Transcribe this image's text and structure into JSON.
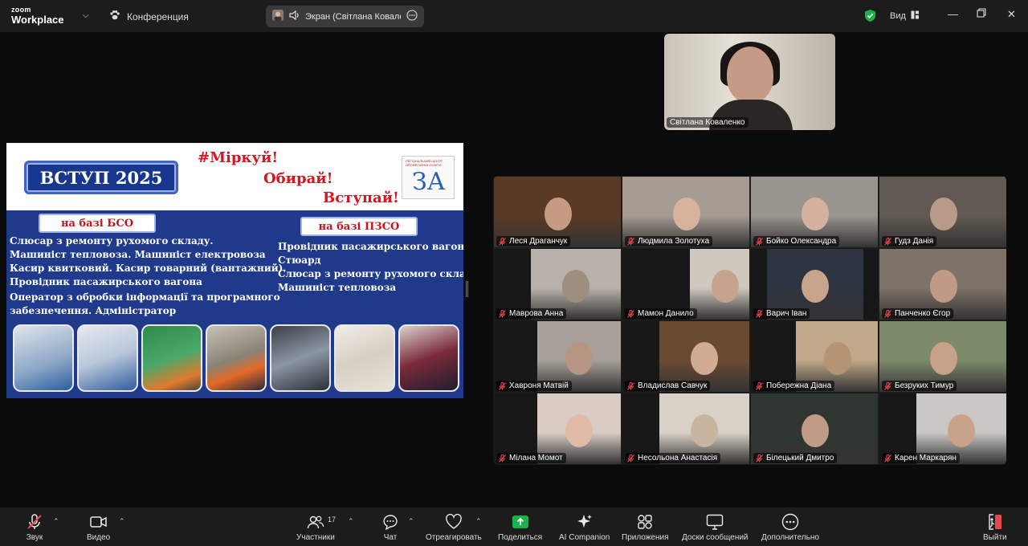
{
  "app": {
    "logo_line1": "zoom",
    "logo_line2": "Workplace",
    "meeting_title": "Конференция",
    "share_label": "Экран (Світлана Коваленко",
    "view_label": "Вид"
  },
  "slide": {
    "title": "ВСТУП 2025",
    "hashtag1": "#Міркуй!",
    "hashtag2": "Обирай!",
    "hashtag3": "Вступай!",
    "logo_letters": "ЗА",
    "logo_text": "РЕГІОНАЛЬНИЙ ЦЕНТР ПРОФЕСІЙНОЇ ОСВІТИ",
    "left_badge": "на базі БСО",
    "right_badge": "на базі ПЗСО",
    "left_list": [
      "Слюсар з ремонту рухомого складу.",
      "Машиніст тепловоза. Машиніст електровоза",
      "Касир квитковий. Касир товарний (вантажний).",
      "Провідник пасажирського вагона",
      "Оператор з обробки інформації  та програмного",
      "забезпечення. Адміністратор"
    ],
    "right_list": [
      "Провідник пасажирського вагона.",
      "Стюард",
      "Слюсар з ремонту рухомого складу.",
      "Машиніст тепловоза"
    ]
  },
  "presenter": {
    "name": "Світлана Коваленко"
  },
  "participants": [
    {
      "name": "Леся Драганчук",
      "bg": "#5a3a24",
      "skin": "#c79a84",
      "video": true
    },
    {
      "name": "Людмила Золотуха",
      "bg": "#a59b92",
      "skin": "#d8b39c",
      "video": true
    },
    {
      "name": "Бойко Олександра",
      "bg": "#9a958f",
      "skin": "#d5b2a0",
      "video": true
    },
    {
      "name": "Гудз Данія",
      "bg": "#615a52",
      "skin": "#b89a88",
      "video": true
    },
    {
      "name": "Маврова Анна",
      "bg": "#b9b2aa",
      "skin": "#9d8e80",
      "video": true
    },
    {
      "name": "Мамон Данило",
      "bg": "#cfc8bf",
      "skin": "#c6a38c",
      "video": true
    },
    {
      "name": "Варич Іван",
      "bg": "#2e3440",
      "skin": "#c9a48d",
      "video": true
    },
    {
      "name": "Панченко Єгор",
      "bg": "#7d7368",
      "skin": "#c09a86",
      "video": true
    },
    {
      "name": "Хавроня Матвій",
      "bg": "#a7a09a",
      "skin": "#b69582",
      "video": true
    },
    {
      "name": "Владислав Савчук",
      "bg": "#6b4a32",
      "skin": "#d1ab94",
      "video": true
    },
    {
      "name": "Побережна Діана",
      "bg": "#c0a888",
      "skin": "#b59473",
      "video": true
    },
    {
      "name": "Безруких Тимур",
      "bg": "#7d8a6c",
      "skin": "#c7a18a",
      "video": true
    },
    {
      "name": "Мілана Момот",
      "bg": "#d8ccc4",
      "skin": "#e0bba8",
      "video": true
    },
    {
      "name": "Несольона Анастасія",
      "bg": "#d9d1c7",
      "skin": "#c8b5a0",
      "video": true
    },
    {
      "name": "Білецький Дмитро",
      "bg": "#2f3631",
      "skin": "#c09b86",
      "video": true
    },
    {
      "name": "Карен Маркарян",
      "bg": "#c9c8c6",
      "skin": "#c9a28a",
      "video": true
    }
  ],
  "toolbar": {
    "audio": "Звук",
    "video": "Видео",
    "participants": "Участники",
    "participants_count": "17",
    "chat": "Чат",
    "react": "Отреагировать",
    "share": "Поделиться",
    "ai": "AI Companion",
    "apps": "Приложения",
    "boards": "Доски сообщений",
    "more": "Дополнительно",
    "leave": "Выйти"
  },
  "colors": {
    "accent_green": "#19b34a",
    "mute_red": "#e5484d",
    "toolbar_bg": "#1c1c1c"
  }
}
